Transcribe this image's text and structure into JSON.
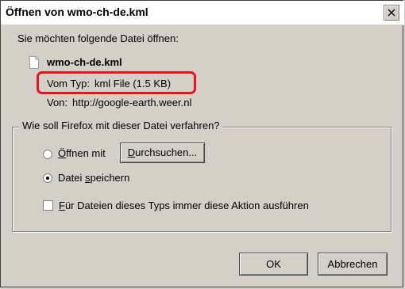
{
  "window": {
    "title": "Öffnen von wmo-ch-de.kml",
    "close_label": "×"
  },
  "intro": "Sie möchten folgende Datei öffnen:",
  "file": {
    "icon": "document-icon",
    "name": "wmo-ch-de.kml",
    "type_label": "Vom Typ:",
    "type_value": "kml File (1.5 KB)",
    "from_label": "Von:",
    "from_value": "http://google-earth.weer.nl"
  },
  "group": {
    "legend": "Wie soll Firefox mit dieser Datei verfahren?",
    "open_with": {
      "first": "Ö",
      "rest": "ffnen mit",
      "selected": false
    },
    "browse_button": {
      "first": "D",
      "rest": "urchsuchen..."
    },
    "save_file": {
      "prefix": "Datei ",
      "accent": "s",
      "rest": "peichern",
      "selected": true
    },
    "always_action": {
      "first": "F",
      "rest": "ür Dateien dieses Typs immer diese Aktion ausführen",
      "checked": false
    }
  },
  "buttons": {
    "ok": "OK",
    "cancel": "Abbrechen"
  },
  "colors": {
    "dialog_bg": "#d4d0c8",
    "highlight": "#e8131b"
  }
}
